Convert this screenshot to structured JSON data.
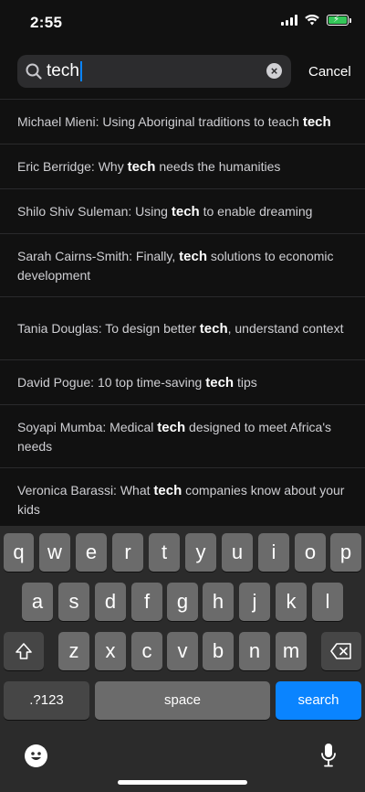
{
  "status_bar": {
    "time": "2:55",
    "battery_color": "#34c759"
  },
  "search": {
    "query": "tech",
    "cancel_label": "Cancel",
    "accent": "#0a84ff"
  },
  "results": [
    {
      "pre": "Michael Mieni: Using Aboriginal traditions to teach ",
      "hl": "tech",
      "post": ""
    },
    {
      "pre": "Eric Berridge: Why ",
      "hl": "tech",
      "post": " needs the humanities"
    },
    {
      "pre": "Shilo Shiv Suleman: Using ",
      "hl": "tech",
      "post": " to enable dreaming"
    },
    {
      "pre": "Sarah Cairns-Smith: Finally, ",
      "hl": "tech",
      "post": " solutions to economic development"
    },
    {
      "pre": "Tania Douglas: To design better ",
      "hl": "tech",
      "post": ", understand context"
    },
    {
      "pre": "David Pogue: 10 top time-saving ",
      "hl": "tech",
      "post": " tips"
    },
    {
      "pre": "Soyapi Mumba: Medical ",
      "hl": "tech",
      "post": " designed to meet Africa's needs"
    },
    {
      "pre": "Veronica Barassi: What ",
      "hl": "tech",
      "post": " companies know about your kids"
    }
  ],
  "keyboard": {
    "row1": [
      "q",
      "w",
      "e",
      "r",
      "t",
      "y",
      "u",
      "i",
      "o",
      "p"
    ],
    "row2": [
      "a",
      "s",
      "d",
      "f",
      "g",
      "h",
      "j",
      "k",
      "l"
    ],
    "row3": [
      "z",
      "x",
      "c",
      "v",
      "b",
      "n",
      "m"
    ],
    "numbers_label": ".?123",
    "space_label": "space",
    "search_label": "search"
  }
}
